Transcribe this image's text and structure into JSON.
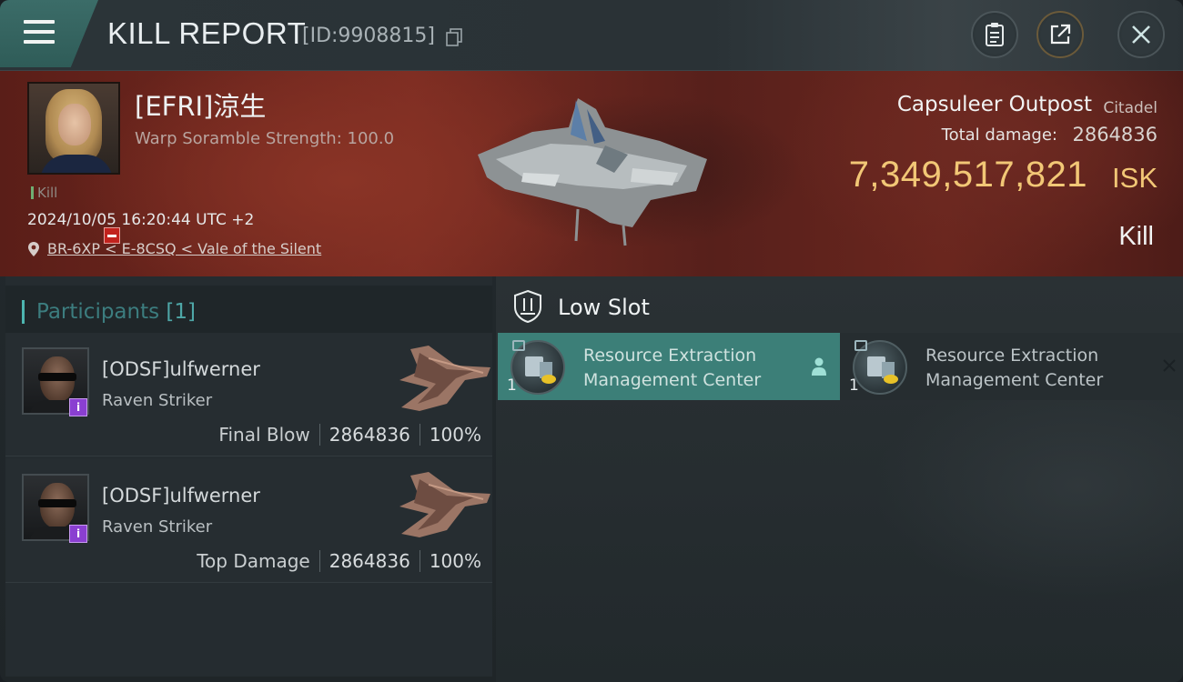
{
  "header": {
    "title": "KILL REPORT",
    "report_id": "[ID:9908815]"
  },
  "victim": {
    "name": "[EFRI]涼生",
    "scramble": "Warp Soramble Strength: 100.0",
    "kill_tag": "Kill",
    "timestamp": "2024/10/05 16:20:44 UTC +2",
    "location": "BR-6XP < E-8CSQ < Vale of the Silent",
    "target_name": "Capsuleer Outpost",
    "target_class": "Citadel",
    "total_damage_label": "Total damage:",
    "total_damage_value": "2864836",
    "isk_value": "7,349,517,821",
    "isk_unit": "ISK",
    "result": "Kill"
  },
  "participants": {
    "label": "Participants",
    "count": "[1]",
    "rows": [
      {
        "name": "[ODSF]ulfwerner",
        "ship": "Raven Striker",
        "role": "Final Blow",
        "damage": "2864836",
        "percent": "100%",
        "badge": "i"
      },
      {
        "name": "[ODSF]ulfwerner",
        "ship": "Raven Striker",
        "role": "Top Damage",
        "damage": "2864836",
        "percent": "100%",
        "badge": "i"
      }
    ]
  },
  "slots": {
    "title": "Low Slot",
    "modules": [
      {
        "name_line1": "Resource Extraction",
        "name_line2": "Management Center",
        "qty": "1",
        "state": "dropped"
      },
      {
        "name_line1": "Resource Extraction",
        "name_line2": "Management Center",
        "qty": "1",
        "state": "destroyed"
      }
    ]
  },
  "colors": {
    "accent_teal": "#3c7f78",
    "isk_gold": "#f2c776",
    "banner_red": "#7c2c22",
    "badge_purple": "#8a3fd1"
  },
  "icons": [
    "menu-icon",
    "copy-icon",
    "clipboard-icon",
    "share-icon",
    "close-icon",
    "pin-icon",
    "shield-icon",
    "person-icon",
    "x-icon"
  ]
}
